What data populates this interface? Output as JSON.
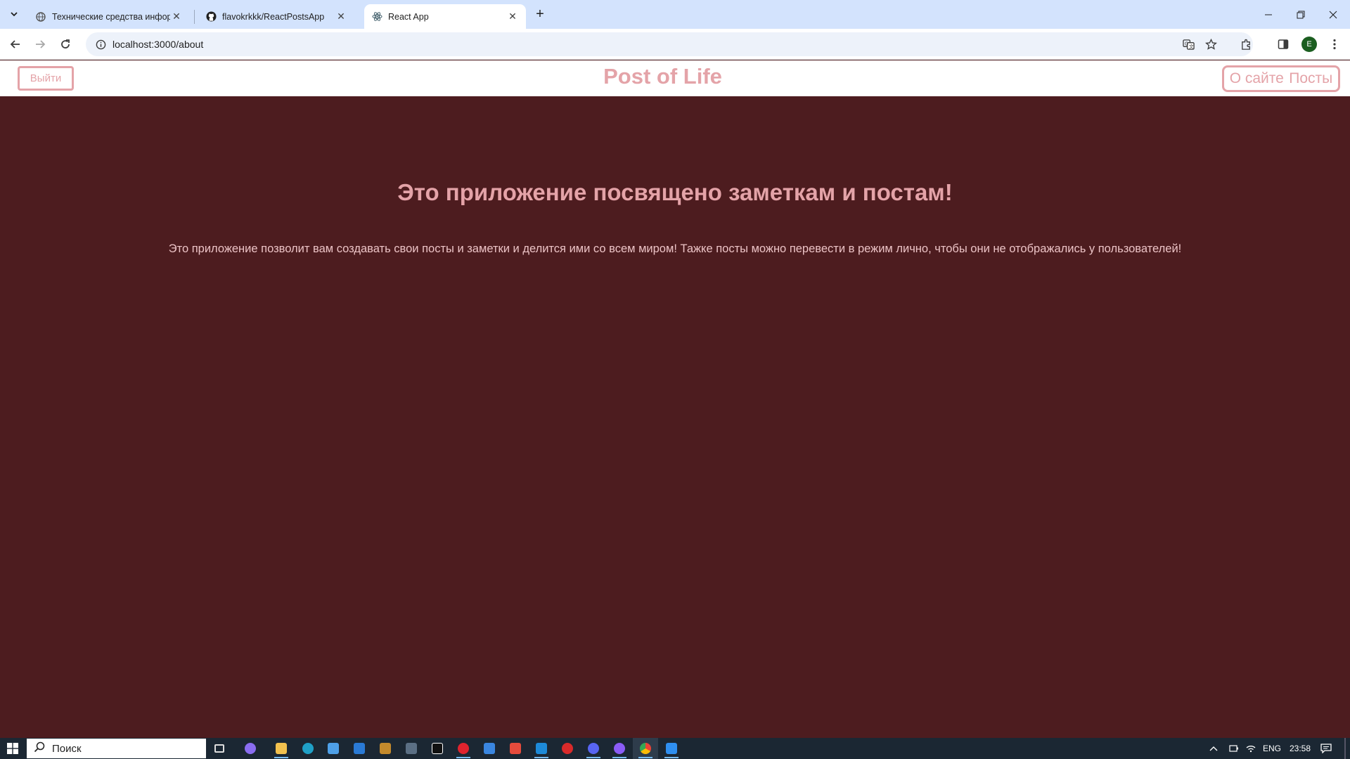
{
  "browser": {
    "tabs": [
      {
        "title": "Технические средства информ",
        "icon": "globe-icon"
      },
      {
        "title": "flavokrkkk/ReactPostsApp",
        "icon": "github-icon"
      },
      {
        "title": "React App",
        "icon": "react-icon",
        "active": true
      }
    ],
    "url": "localhost:3000/about",
    "profile_initial": "E"
  },
  "header": {
    "logout_label": "Выйти",
    "site_title": "Post of Life",
    "nav": {
      "about_label": "О сайте",
      "posts_label": "Посты"
    }
  },
  "main": {
    "title": "Это приложение посвящено заметкам и постам!",
    "text": "Это приложение позволит вам создавать свои посты и заметки и делится ими со всем миром! Тажке посты можно перевести в режим лично, чтобы они не отображались у пользователей!"
  },
  "taskbar": {
    "search_placeholder": "Поиск",
    "language": "ENG",
    "time": "23:58",
    "pinned": [
      "task-view",
      "copilot",
      "file-explorer",
      "edge",
      "store",
      "mail",
      "game-a",
      "app-b",
      "pycharm",
      "opera",
      "shield",
      "yandex",
      "vscode",
      "app-red",
      "discord",
      "github-desktop",
      "chrome",
      "app-blue"
    ]
  },
  "colors": {
    "accent": "#e4a3a8",
    "page_bg": "#4d1c1f",
    "header_bg": "#ffffff"
  }
}
